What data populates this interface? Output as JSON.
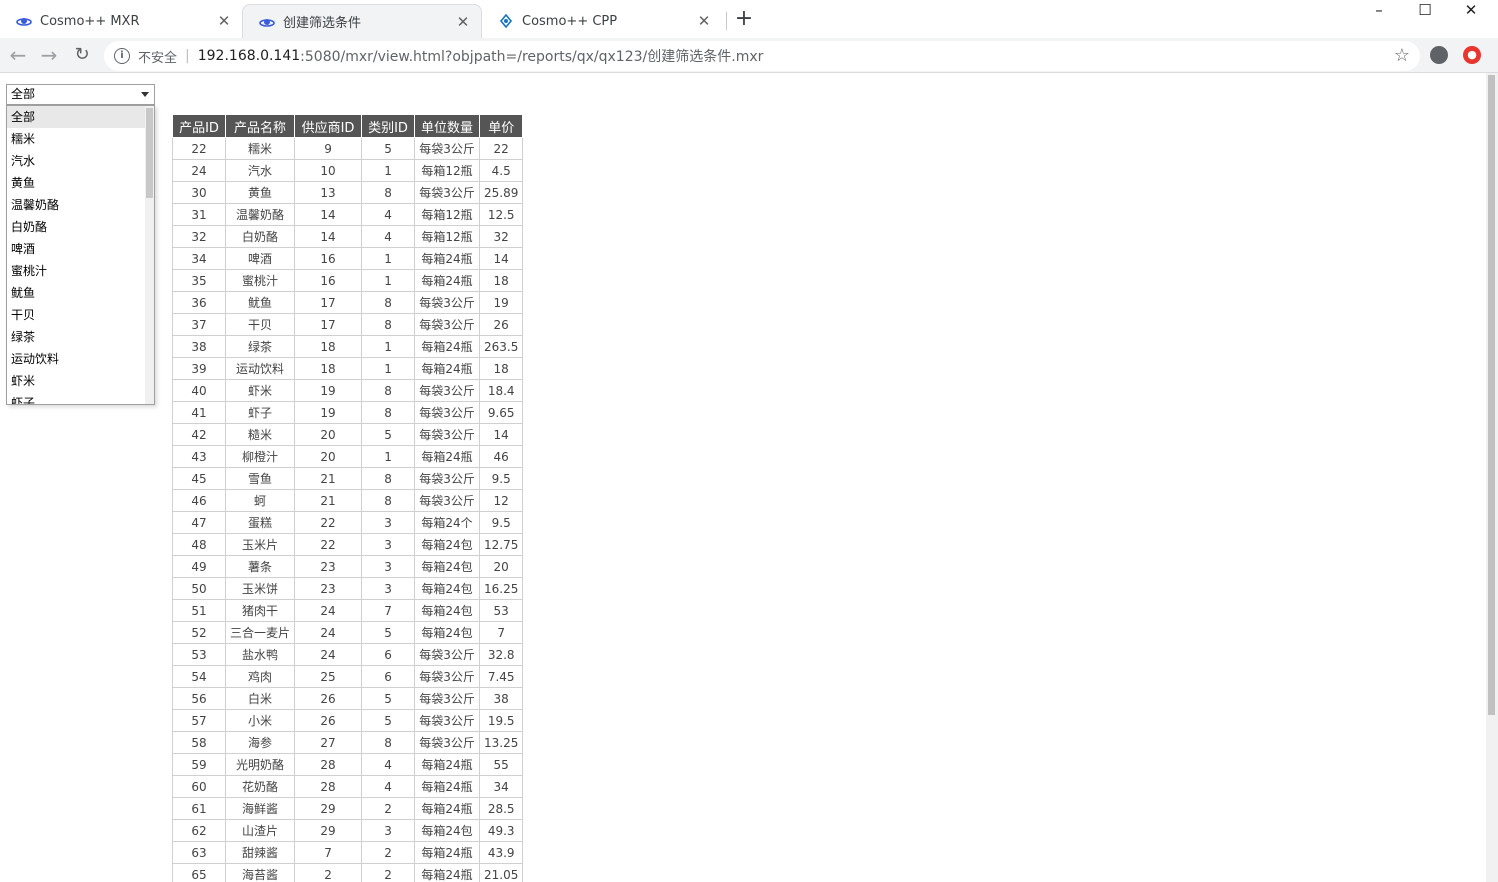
{
  "browser": {
    "tabs": [
      {
        "title": "Cosmo++ MXR",
        "active": false
      },
      {
        "title": "创建筛选条件",
        "active": true
      },
      {
        "title": "Cosmo++ CPP",
        "active": false
      }
    ],
    "new_tab": "+",
    "window_controls": {
      "minimize": "–",
      "maximize": "☐",
      "close": "✕"
    },
    "address": {
      "security_label": "不安全",
      "host": "192.168.0.141",
      "rest": ":5080/mxr/view.html?objpath=/reports/qx/qx123/创建筛选条件.mxr"
    }
  },
  "filter": {
    "selected": "全部",
    "options": [
      "全部",
      "糯米",
      "汽水",
      "黄鱼",
      "温馨奶酪",
      "白奶酪",
      "啤酒",
      "蜜桃汁",
      "鱿鱼",
      "干贝",
      "绿茶",
      "运动饮料",
      "虾米",
      "虾子"
    ]
  },
  "table": {
    "headers": [
      "产品ID",
      "产品名称",
      "供应商ID",
      "类别ID",
      "单位数量",
      "单价"
    ],
    "rows": [
      [
        "22",
        "糯米",
        "9",
        "5",
        "每袋3公斤",
        "22"
      ],
      [
        "24",
        "汽水",
        "10",
        "1",
        "每箱12瓶",
        "4.5"
      ],
      [
        "30",
        "黄鱼",
        "13",
        "8",
        "每袋3公斤",
        "25.89"
      ],
      [
        "31",
        "温馨奶酪",
        "14",
        "4",
        "每箱12瓶",
        "12.5"
      ],
      [
        "32",
        "白奶酪",
        "14",
        "4",
        "每箱12瓶",
        "32"
      ],
      [
        "34",
        "啤酒",
        "16",
        "1",
        "每箱24瓶",
        "14"
      ],
      [
        "35",
        "蜜桃汁",
        "16",
        "1",
        "每箱24瓶",
        "18"
      ],
      [
        "36",
        "鱿鱼",
        "17",
        "8",
        "每袋3公斤",
        "19"
      ],
      [
        "37",
        "干贝",
        "17",
        "8",
        "每袋3公斤",
        "26"
      ],
      [
        "38",
        "绿茶",
        "18",
        "1",
        "每箱24瓶",
        "263.5"
      ],
      [
        "39",
        "运动饮料",
        "18",
        "1",
        "每箱24瓶",
        "18"
      ],
      [
        "40",
        "虾米",
        "19",
        "8",
        "每袋3公斤",
        "18.4"
      ],
      [
        "41",
        "虾子",
        "19",
        "8",
        "每袋3公斤",
        "9.65"
      ],
      [
        "42",
        "糙米",
        "20",
        "5",
        "每袋3公斤",
        "14"
      ],
      [
        "43",
        "柳橙汁",
        "20",
        "1",
        "每箱24瓶",
        "46"
      ],
      [
        "45",
        "雪鱼",
        "21",
        "8",
        "每袋3公斤",
        "9.5"
      ],
      [
        "46",
        "蚵",
        "21",
        "8",
        "每袋3公斤",
        "12"
      ],
      [
        "47",
        "蛋糕",
        "22",
        "3",
        "每箱24个",
        "9.5"
      ],
      [
        "48",
        "玉米片",
        "22",
        "3",
        "每箱24包",
        "12.75"
      ],
      [
        "49",
        "薯条",
        "23",
        "3",
        "每箱24包",
        "20"
      ],
      [
        "50",
        "玉米饼",
        "23",
        "3",
        "每箱24包",
        "16.25"
      ],
      [
        "51",
        "猪肉干",
        "24",
        "7",
        "每箱24包",
        "53"
      ],
      [
        "52",
        "三合一麦片",
        "24",
        "5",
        "每箱24包",
        "7"
      ],
      [
        "53",
        "盐水鸭",
        "24",
        "6",
        "每袋3公斤",
        "32.8"
      ],
      [
        "54",
        "鸡肉",
        "25",
        "6",
        "每袋3公斤",
        "7.45"
      ],
      [
        "56",
        "白米",
        "26",
        "5",
        "每袋3公斤",
        "38"
      ],
      [
        "57",
        "小米",
        "26",
        "5",
        "每袋3公斤",
        "19.5"
      ],
      [
        "58",
        "海参",
        "27",
        "8",
        "每袋3公斤",
        "13.25"
      ],
      [
        "59",
        "光明奶酪",
        "28",
        "4",
        "每箱24瓶",
        "55"
      ],
      [
        "60",
        "花奶酪",
        "28",
        "4",
        "每箱24瓶",
        "34"
      ],
      [
        "61",
        "海鲜酱",
        "29",
        "2",
        "每箱24瓶",
        "28.5"
      ],
      [
        "62",
        "山渣片",
        "29",
        "3",
        "每箱24包",
        "49.3"
      ],
      [
        "63",
        "甜辣酱",
        "7",
        "2",
        "每箱24瓶",
        "43.9"
      ],
      [
        "65",
        "海苔酱",
        "2",
        "2",
        "每箱24瓶",
        "21.05"
      ]
    ]
  }
}
